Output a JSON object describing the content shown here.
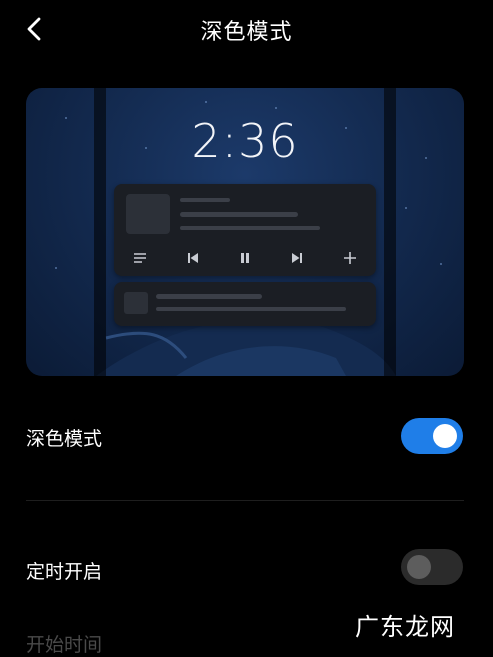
{
  "header": {
    "back_icon": "chevron-left-icon",
    "title": "深色模式"
  },
  "preview": {
    "clock": "2:36",
    "media_controls": [
      "menu-icon",
      "previous-icon",
      "pause-icon",
      "next-icon",
      "plus-icon"
    ]
  },
  "settings": {
    "dark_mode": {
      "label": "深色模式",
      "enabled": true
    },
    "scheduled": {
      "label": "定时开启",
      "enabled": false
    },
    "start_time": {
      "label": "开始时间"
    }
  },
  "watermark": "广东龙网",
  "colors": {
    "background": "#000000",
    "toggle_on": "#1f7ee8",
    "toggle_off": "#2b2b2b"
  }
}
